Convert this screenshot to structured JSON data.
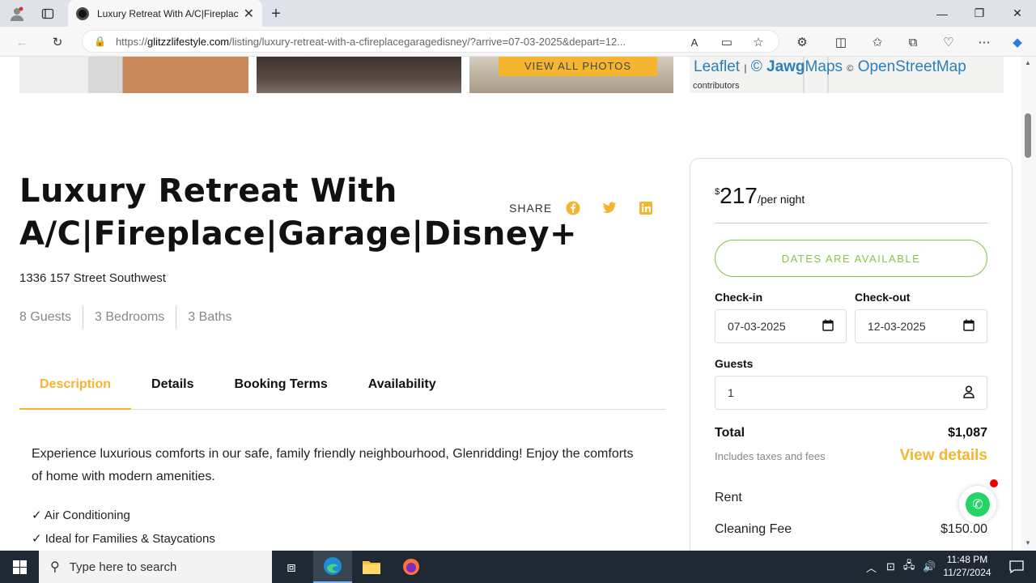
{
  "browser": {
    "tab_title": "Luxury Retreat With A/C|Fireplac",
    "url_prefix": "https://",
    "url_host": "glitzzlifestyle.com",
    "url_path": "/listing/luxury-retreat-with-a-cfireplacegaragedisney/?arrive=07-03-2025&depart=12..."
  },
  "gallery": {
    "view_all_label": "VIEW ALL PHOTOS"
  },
  "map": {
    "leaflet": "Leaflet",
    "separator": "|",
    "copyright": "©",
    "jawg": "Jawg",
    "maps": "Maps",
    "osm_copy": "©",
    "osm": "OpenStreetMap",
    "contributors": "contributors"
  },
  "listing": {
    "title": "Luxury Retreat With A/C|Fireplace|Garage|Disney+",
    "share_label": "SHARE",
    "address": "1336 157 Street Southwest",
    "guests": "8 Guests",
    "bedrooms": "3 Bedrooms",
    "baths": "3 Baths"
  },
  "tabs": [
    "Description",
    "Details",
    "Booking Terms",
    "Availability"
  ],
  "description": {
    "text": "Experience luxurious comforts in our safe, family friendly neighbourhood, Glenridding! Enjoy the comforts of home with modern amenities.",
    "features": [
      "✓ Air Conditioning",
      "✓ Ideal for Families & Staycations"
    ]
  },
  "booking": {
    "currency": "$",
    "price": "217",
    "per_night": "/per night",
    "availability_label": "DATES ARE AVAILABLE",
    "checkin_label": "Check-in",
    "checkin_value": "07-03-2025",
    "checkout_label": "Check-out",
    "checkout_value": "12-03-2025",
    "guests_label": "Guests",
    "guests_value": "1",
    "total_label": "Total",
    "total_value": "$1,087",
    "includes_label": "Includes taxes and fees",
    "view_details_label": "View details",
    "rent_label": "Rent",
    "cleaning_label": "Cleaning Fee",
    "cleaning_value": "$150.00"
  },
  "taskbar": {
    "search_placeholder": "Type here to search",
    "time": "11:48 PM",
    "date": "11/27/2024"
  },
  "colors": {
    "accent": "#f5b52e",
    "available": "#8bc34a",
    "link": "#2c7fb8"
  }
}
